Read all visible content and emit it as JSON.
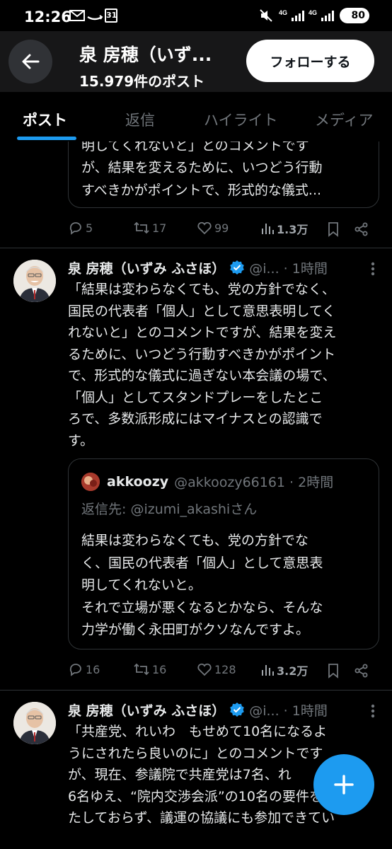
{
  "status_bar": {
    "time": "12:26",
    "calendar_day": "31",
    "battery": "80"
  },
  "header": {
    "title": "泉 房穂（いず...",
    "post_count": "15.979件のポスト",
    "follow_label": "フォローする"
  },
  "tabs": [
    "ポスト",
    "返信",
    "ハイライト",
    "メディア"
  ],
  "partial_quote": {
    "lines": [
      "明してくれないと」とのコメントです",
      "が、結果を変えるために、いつどう行動",
      "すべきかがポイントで、形式的な儀式..."
    ]
  },
  "partial_actions": {
    "replies": "5",
    "reposts": "17",
    "likes": "99",
    "views": "1.3万"
  },
  "tweet1": {
    "name": "泉 房穂（いずみ ふさほ）",
    "meta": "@i... · 1時間",
    "lines": [
      "「結果は変わらなくても、党の方針でなく、",
      "国民の代表者「個人」として意思表明してく",
      "れないと」とのコメントですが、結果を変え",
      "るために、いつどう行動すべきかがポイント",
      "で、形式的な儀式に過ぎない本会議の場で、",
      "「個人」としてスタンドプレーをしたとこ",
      "ろで、多数派形成にはマイナスとの認識で",
      "す。"
    ],
    "quote": {
      "name": "akkoozy",
      "meta": "@akkoozy66161 · 2時間",
      "reply_to": "返信先: @izumi_akashiさん",
      "lines": [
        "結果は変わらなくても、党の方針でな",
        "く、国民の代表者「個人」として意思表",
        "明してくれないと。",
        "それで立場が悪くなるとかなら、そんな",
        "力学が働く永田町がクソなんですよ。"
      ]
    },
    "actions": {
      "replies": "16",
      "reposts": "16",
      "likes": "128",
      "views": "3.2万"
    }
  },
  "tweet2": {
    "name": "泉 房穂（いずみ ふさほ）",
    "meta": "@i... · 1時間",
    "lines": [
      "「共産党、れいわ　もせめて10名になるよ",
      "うにされたら良いのに」とのコメントです",
      "が、現在、参議院で共産党は7名、れ",
      "6名ゆえ、“院内交渉会派”の10名の要件を満",
      "たしておらず、議運の協議にも参加できてい"
    ]
  },
  "colors": {
    "accent": "#1d9bf0",
    "background": "#000000",
    "header_bg": "#171718",
    "muted_text": "#71767b",
    "border": "#2f3336"
  }
}
